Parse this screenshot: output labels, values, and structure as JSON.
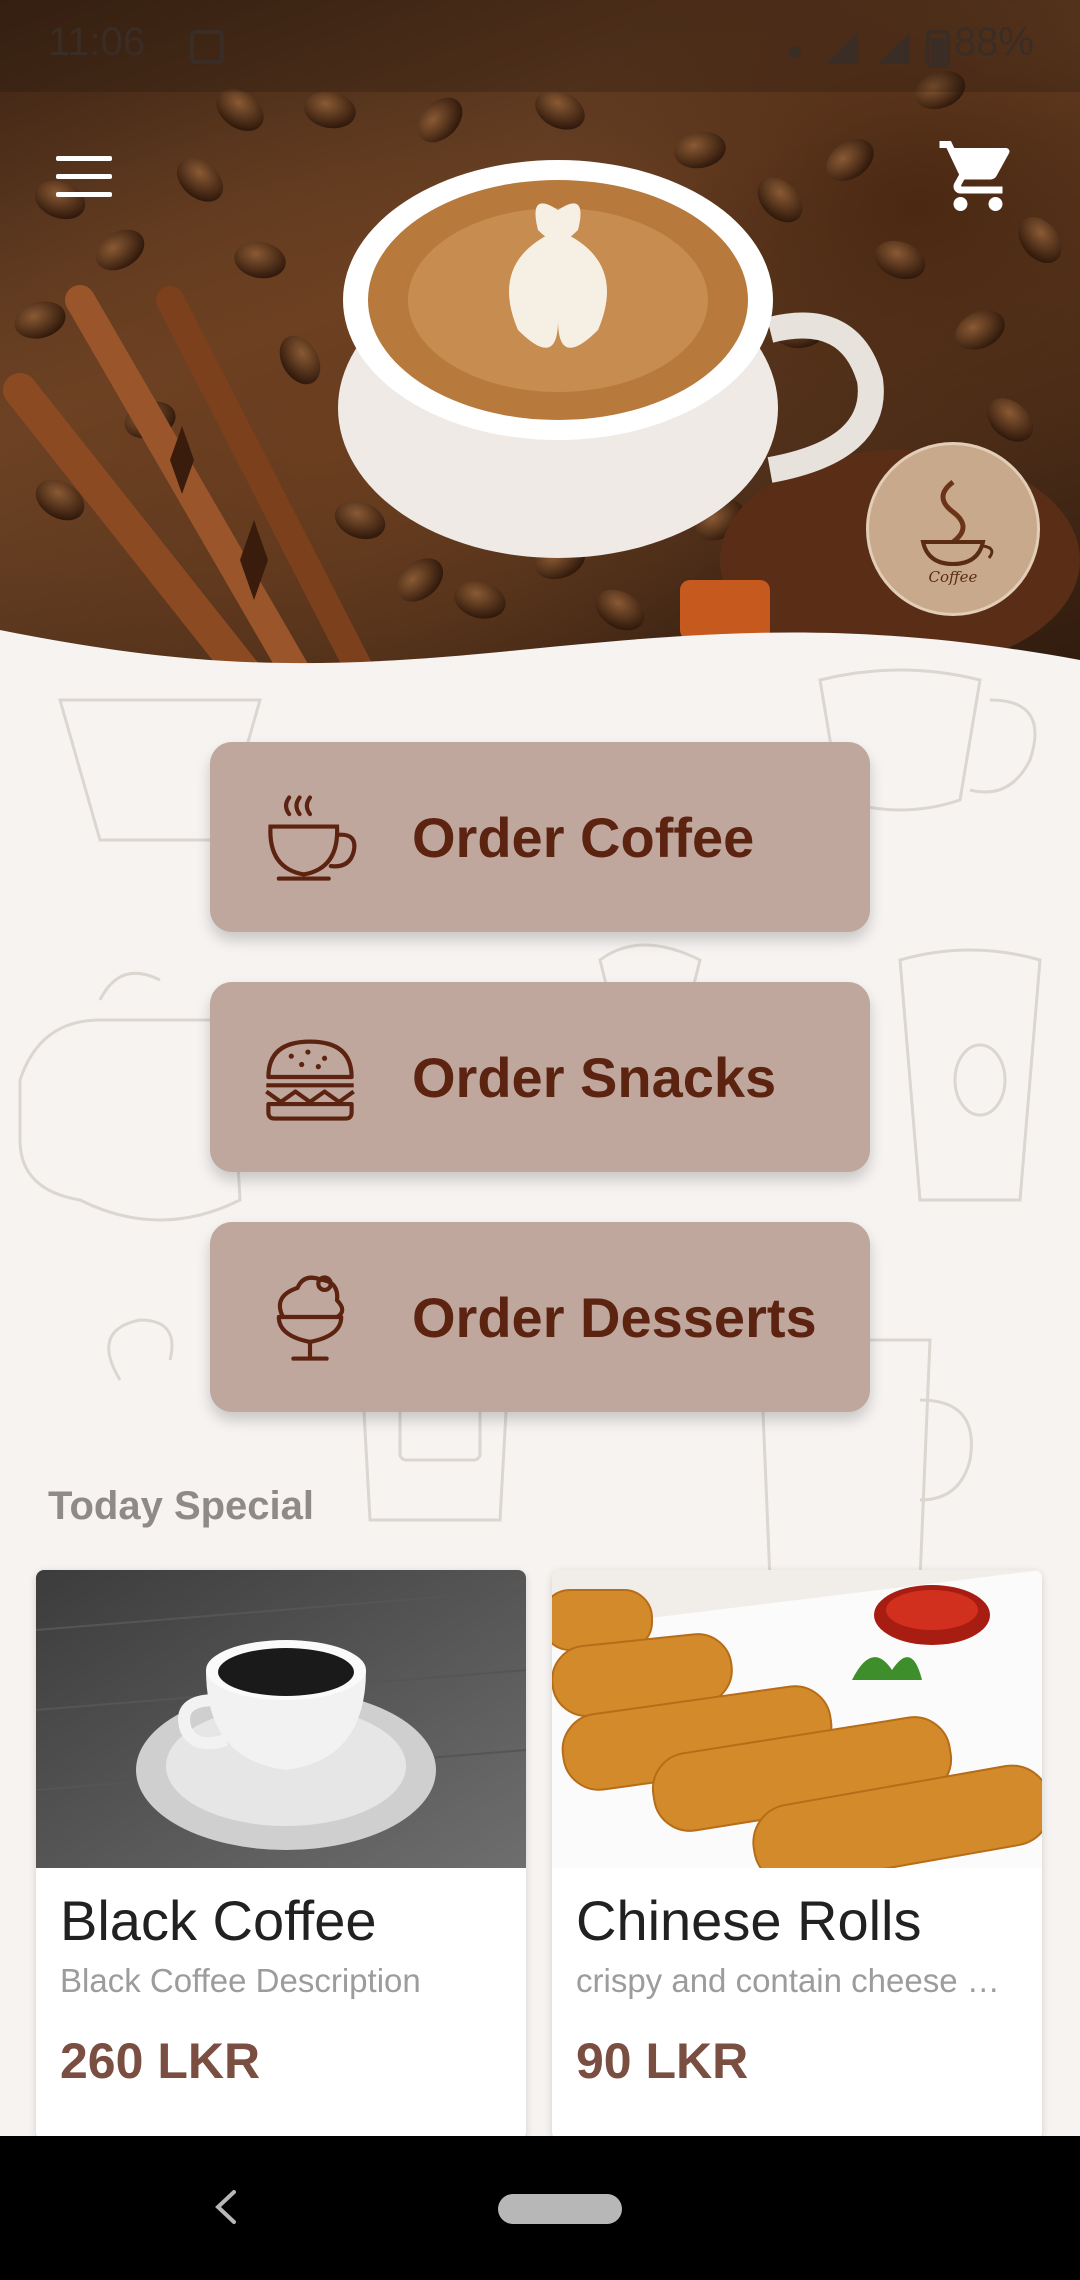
{
  "status_bar": {
    "time": "11:06",
    "battery": "88%"
  },
  "header": {
    "logo_text": "Coffee"
  },
  "orders": [
    {
      "label": "Order Coffee",
      "icon": "coffee-cup-icon"
    },
    {
      "label": "Order Snacks",
      "icon": "burger-icon"
    },
    {
      "label": "Order Desserts",
      "icon": "ice-cream-icon"
    }
  ],
  "today_special": {
    "title": "Today Special",
    "items": [
      {
        "name": "Black Coffee",
        "description": "Black Coffee Description",
        "price": "260 LKR"
      },
      {
        "name": "Chinese Rolls",
        "description": "crispy and contain cheese …",
        "price": "90 LKR"
      }
    ]
  },
  "colors": {
    "button_bg": "#bfa79d",
    "button_text": "#5c2310",
    "price_text": "#7a4e40",
    "page_bg": "#f6f3f1"
  }
}
